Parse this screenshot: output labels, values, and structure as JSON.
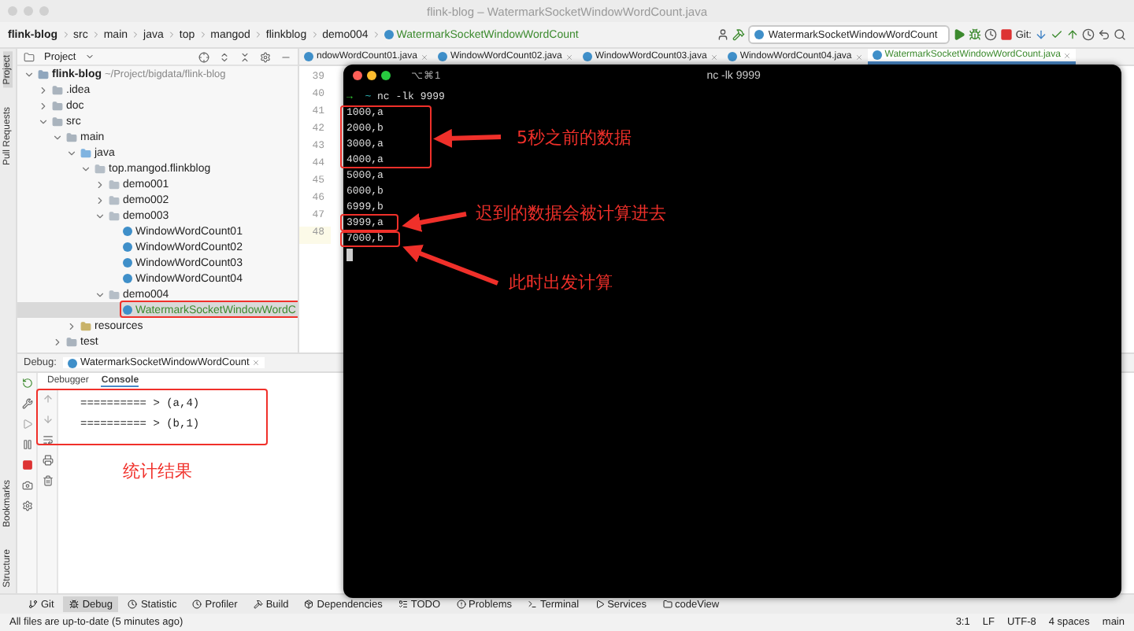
{
  "window": {
    "title": "flink-blog – WatermarkSocketWindowWordCount.java"
  },
  "breadcrumbs": [
    {
      "text": "flink-blog",
      "kind": "project"
    },
    {
      "text": "src",
      "kind": "folder"
    },
    {
      "text": "main",
      "kind": "folder"
    },
    {
      "text": "java",
      "kind": "folder"
    },
    {
      "text": "top",
      "kind": "folder"
    },
    {
      "text": "mangod",
      "kind": "folder"
    },
    {
      "text": "flinkblog",
      "kind": "folder"
    },
    {
      "text": "demo004",
      "kind": "folder"
    },
    {
      "text": "WatermarkSocketWindowWordCount",
      "kind": "class"
    }
  ],
  "run_config": {
    "value": "WatermarkSocketWindowWordCount"
  },
  "git_label": "Git:",
  "side_tools_top": [
    {
      "label": "Project",
      "selected": true
    },
    {
      "label": "Pull Requests",
      "selected": false
    }
  ],
  "side_tools_bottom": [
    {
      "label": "Bookmarks",
      "selected": false
    },
    {
      "label": "Structure",
      "selected": false
    }
  ],
  "project_panel": {
    "title": "Project",
    "tree": [
      {
        "label": "flink-blog",
        "path": "~/Project/bigdata/flink-blog",
        "kind": "module",
        "expanded": true,
        "selected": false,
        "children": [
          {
            "label": ".idea",
            "kind": "folder",
            "expanded": false,
            "selected": false
          },
          {
            "label": "doc",
            "kind": "folder",
            "expanded": false,
            "selected": false
          },
          {
            "label": "src",
            "kind": "folder",
            "expanded": true,
            "selected": false,
            "children": [
              {
                "label": "main",
                "kind": "folder",
                "expanded": true,
                "selected": false,
                "children": [
                  {
                    "label": "java",
                    "kind": "source",
                    "expanded": true,
                    "selected": false,
                    "children": [
                      {
                        "label": "top.mangod.flinkblog",
                        "kind": "package",
                        "expanded": true,
                        "selected": false,
                        "children": [
                          {
                            "label": "demo001",
                            "kind": "package",
                            "expanded": false,
                            "selected": false
                          },
                          {
                            "label": "demo002",
                            "kind": "package",
                            "expanded": false,
                            "selected": false
                          },
                          {
                            "label": "demo003",
                            "kind": "package",
                            "expanded": true,
                            "selected": false,
                            "children": [
                              {
                                "label": "WindowWordCount01",
                                "kind": "class",
                                "color": "#1f1f1f",
                                "selected": false
                              },
                              {
                                "label": "WindowWordCount02",
                                "kind": "class",
                                "color": "#1f1f1f",
                                "selected": false
                              },
                              {
                                "label": "WindowWordCount03",
                                "kind": "class",
                                "color": "#1f1f1f",
                                "selected": false
                              },
                              {
                                "label": "WindowWordCount04",
                                "kind": "class",
                                "color": "#1f1f1f",
                                "selected": false
                              }
                            ]
                          },
                          {
                            "label": "demo004",
                            "kind": "package",
                            "expanded": true,
                            "selected": false,
                            "children": [
                              {
                                "label": "WatermarkSocketWindowWordC",
                                "kind": "class",
                                "color": "#3c8a2e",
                                "selected": true
                              }
                            ]
                          }
                        ]
                      }
                    ]
                  },
                  {
                    "label": "resources",
                    "kind": "resources",
                    "expanded": false,
                    "selected": false
                  }
                ]
              },
              {
                "label": "test",
                "kind": "folder",
                "expanded": false,
                "selected": false
              }
            ]
          }
        ]
      }
    ]
  },
  "editor": {
    "tabs": [
      {
        "label": "ndowWordCount01.java",
        "selected": false
      },
      {
        "label": "WindowWordCount02.java",
        "selected": false
      },
      {
        "label": "WindowWordCount03.java",
        "selected": false
      },
      {
        "label": "WindowWordCount04.java",
        "selected": false
      },
      {
        "label": "WatermarkSocketWindowWordCount.java",
        "selected": true
      }
    ],
    "line_numbers": [
      {
        "text": "39",
        "current": false
      },
      {
        "text": "40",
        "current": false
      },
      {
        "text": "41",
        "current": false
      },
      {
        "text": "42",
        "current": false
      },
      {
        "text": "43",
        "current": false
      },
      {
        "text": "44",
        "current": false
      },
      {
        "text": "45",
        "current": false
      },
      {
        "text": "46",
        "current": false
      },
      {
        "text": "47",
        "current": false
      },
      {
        "text": "48",
        "current": true
      }
    ]
  },
  "debug": {
    "label": "Debug:",
    "session": "WatermarkSocketWindowWordCount",
    "tabs": [
      {
        "label": "Debugger",
        "selected": false
      },
      {
        "label": "Console",
        "selected": true
      }
    ],
    "console_lines": [
      "========== > (a,4)",
      "========== > (b,1)"
    ]
  },
  "terminal": {
    "shortcut": "⌥⌘1",
    "title": "nc -lk 9999",
    "prompt_symbol": "→",
    "prompt": "~",
    "command": "nc -lk 9999",
    "lines": [
      "1000,a",
      "2000,b",
      "3000,a",
      "4000,a",
      "5000,a",
      "6000,b",
      "6999,b",
      "3999,a",
      "7000,b"
    ]
  },
  "annotations": [
    "5秒之前的数据",
    "迟到的数据会被计算进去",
    "此时出发计算",
    "统计结果"
  ],
  "tool_windows": [
    {
      "label": "Git",
      "selected": false
    },
    {
      "label": "Debug",
      "selected": true
    },
    {
      "label": "Statistic",
      "selected": false
    },
    {
      "label": "Profiler",
      "selected": false
    },
    {
      "label": "Build",
      "selected": false
    },
    {
      "label": "Dependencies",
      "selected": false
    },
    {
      "label": "TODO",
      "selected": false
    },
    {
      "label": "Problems",
      "selected": false
    },
    {
      "label": "Terminal",
      "selected": false
    },
    {
      "label": "Services",
      "selected": false
    },
    {
      "label": "codeView",
      "selected": false
    }
  ],
  "status_bar": {
    "message": "All files are up-to-date (5 minutes ago)",
    "items": [
      "3:1",
      "LF",
      "UTF-8",
      "4 spaces",
      "main"
    ]
  }
}
